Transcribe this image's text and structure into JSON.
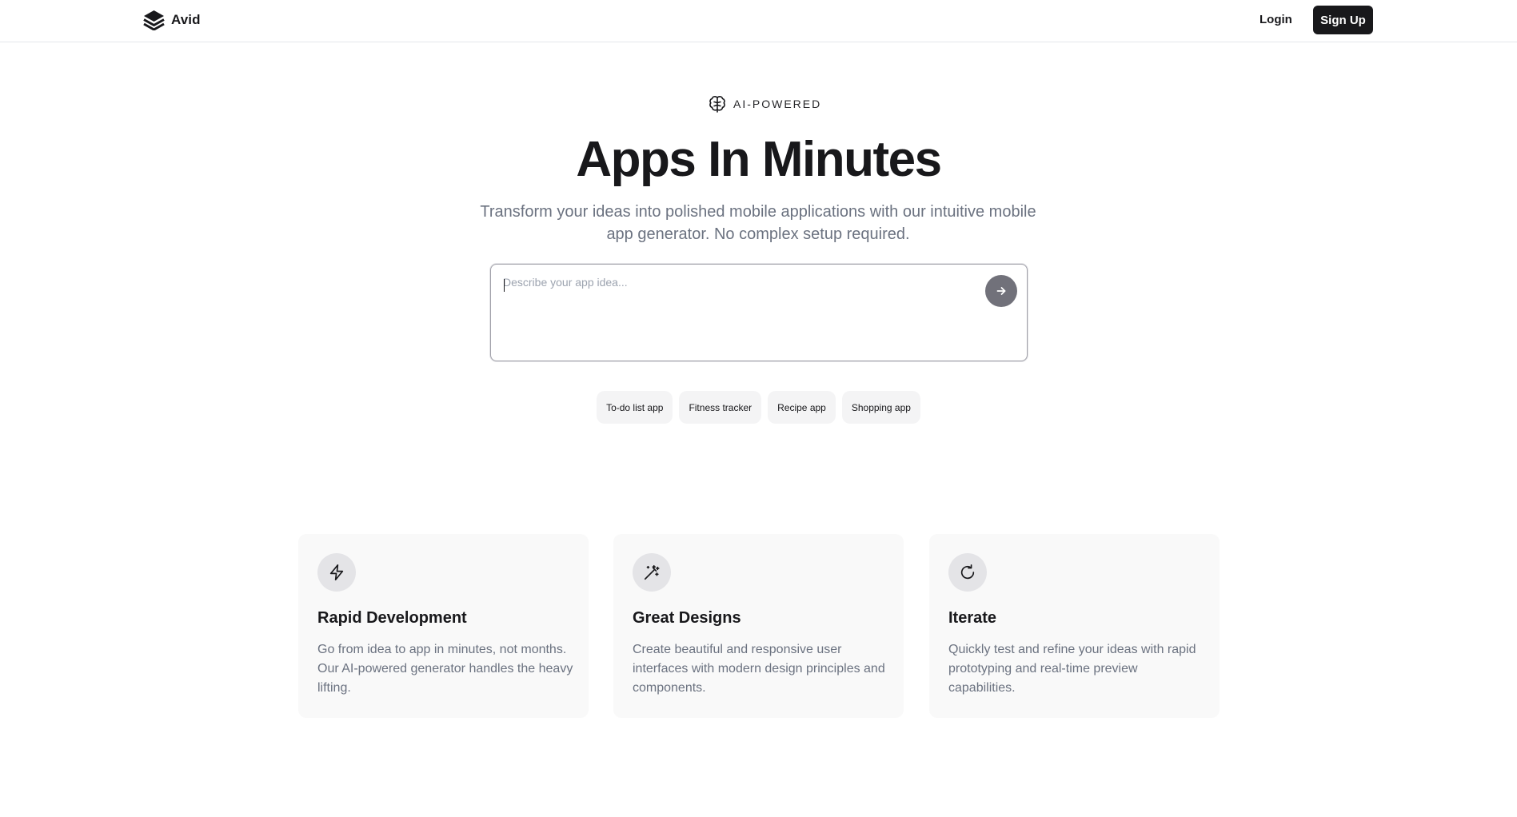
{
  "nav": {
    "brand_name": "Avid",
    "login_label": "Login",
    "signup_label": "Sign Up"
  },
  "hero": {
    "badge_text": "AI-POWERED",
    "title": "Apps In Minutes",
    "subtitle": "Transform your ideas into polished mobile applications with our intuitive mobile app generator. No complex setup required."
  },
  "prompt": {
    "placeholder": "Describe your app idea...",
    "value": "",
    "submit_icon": "arrow-right-icon"
  },
  "suggestions": [
    "To-do list app",
    "Fitness tracker",
    "Recipe app",
    "Shopping app"
  ],
  "features": [
    {
      "icon": "zap-icon",
      "title": "Rapid Development",
      "description": "Go from idea to app in minutes, not months. Our AI-powered generator handles the heavy lifting."
    },
    {
      "icon": "wand-sparkles-icon",
      "title": "Great Designs",
      "description": "Create beautiful and responsive user interfaces with modern design principles and components."
    },
    {
      "icon": "refresh-icon",
      "title": "Iterate",
      "description": "Quickly test and refine your ideas with rapid prototyping and real-time preview capabilities."
    }
  ],
  "colors": {
    "primary": "#18181b",
    "muted_text": "#6b7280",
    "card_bg": "#f9f9f9",
    "chip_bg": "#f4f4f5",
    "submit_bg": "#71717a"
  }
}
